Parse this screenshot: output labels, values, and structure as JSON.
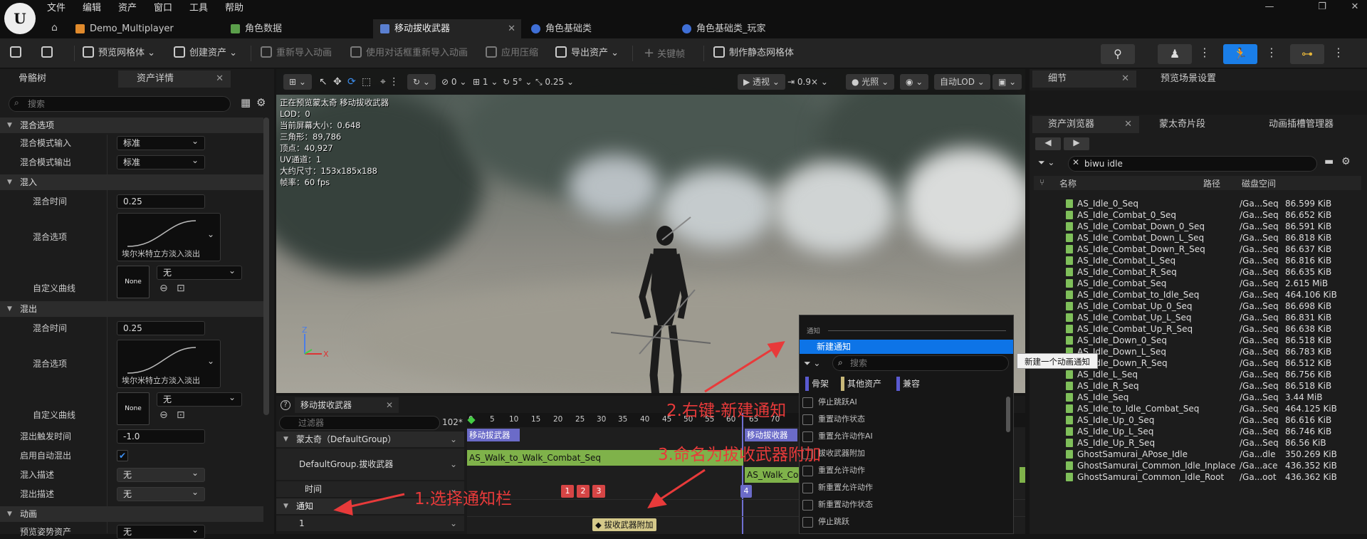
{
  "menu": {
    "items": [
      "文件",
      "编辑",
      "资产",
      "窗口",
      "工具",
      "帮助"
    ]
  },
  "tabs": [
    {
      "label": "Demo_Multiplayer"
    },
    {
      "label": "角色数据"
    },
    {
      "label": "移动拔收武器"
    },
    {
      "label": "角色基础类"
    },
    {
      "label": "角色基础类_玩家"
    }
  ],
  "toolbar": {
    "preview_mesh": "预览网格体",
    "create_asset": "创建资产",
    "reimport": "重新导入动画",
    "reimport_dialog": "使用对话框重新导入动画",
    "apply_compression": "应用压缩",
    "export_asset": "导出资产",
    "keyframe": "关键帧",
    "make_static_mesh": "制作静态网格体"
  },
  "left_panel": {
    "tabs": [
      "骨骼树",
      "资产详情"
    ],
    "search_placeholder": "搜索",
    "sections": {
      "blend_options": "混合选项",
      "blend_in": "混入",
      "blend_out": "混出",
      "animation": "动画"
    },
    "blend_mode_in_label": "混合模式输入",
    "blend_mode_in_value": "标准",
    "blend_mode_out_label": "混合模式输出",
    "blend_mode_out_value": "标准",
    "blend_time_label": "混合时间",
    "blend_in_time": "0.25",
    "blend_out_time": "0.25",
    "blend_option_label": "混合选项",
    "curve_caption": "埃尔米特立方淡入淡出",
    "custom_curve_label": "自定义曲线",
    "none_label": "None",
    "none_value": "无",
    "blend_out_trigger_label": "混出触发时间",
    "blend_out_trigger_value": "-1.0",
    "auto_blend_label": "启用自动混出",
    "blend_in_desc_label": "混入描述",
    "blend_in_desc_value": "无",
    "blend_out_desc_label": "混出描述",
    "blend_out_desc_value": "无",
    "preview_pose_label": "预览姿势资产",
    "preview_pose_value": "无"
  },
  "viewport": {
    "perspective": "透视",
    "lighting": "光照",
    "auto_lod": "自动LOD",
    "snap_values": [
      "0",
      "1",
      "5°",
      "0.25"
    ],
    "speed": "0.9×",
    "stats": [
      "正在预览蒙太奇 移动拔收武器",
      "LOD：0",
      "当前屏幕大小：0.648",
      "三角形：89,786",
      "顶点：40,927",
      "UV通道：1",
      "大约尺寸：153x185x188",
      "帧率：60 fps"
    ]
  },
  "sequencer": {
    "tab": "移动拔收武器",
    "filter_placeholder": "过滤器",
    "frame_count": "102*",
    "montage_row": "蒙太奇（DefaultGroup）",
    "slot_row": "DefaultGroup.拔收武器",
    "time_row": "时间",
    "notify_row": "通知",
    "notify_track": "1",
    "ticks": [
      "0",
      "5",
      "10",
      "15",
      "20",
      "25",
      "30",
      "35",
      "40",
      "45",
      "50",
      "55",
      "60",
      "65",
      "70"
    ],
    "section_a": "移动拔武器",
    "section_b": "移动拔收器",
    "clip_a": "AS_Walk_to_Walk_Combat_Seq",
    "clip_b": "AS_Walk_Co",
    "frames": [
      "1",
      "2",
      "3",
      "4"
    ],
    "notify_marker": "拔收武器附加"
  },
  "right_panel": {
    "tabs_top": [
      "细节",
      "预览场景设置"
    ],
    "tabs_mid": [
      "资产浏览器",
      "蒙太奇片段",
      "动画插槽管理器"
    ],
    "search_value": "biwu idle",
    "columns": [
      "名称",
      "路径",
      "磁盘空间"
    ],
    "assets": [
      {
        "name": "AS_Idle_0_Seq",
        "path": "/Ga...Seq",
        "size": "86.599 KiB"
      },
      {
        "name": "AS_Idle_Combat_0_Seq",
        "path": "/Ga...Seq",
        "size": "86.652 KiB"
      },
      {
        "name": "AS_Idle_Combat_Down_0_Seq",
        "path": "/Ga...Seq",
        "size": "86.591 KiB"
      },
      {
        "name": "AS_Idle_Combat_Down_L_Seq",
        "path": "/Ga...Seq",
        "size": "86.818 KiB"
      },
      {
        "name": "AS_Idle_Combat_Down_R_Seq",
        "path": "/Ga...Seq",
        "size": "86.637 KiB"
      },
      {
        "name": "AS_Idle_Combat_L_Seq",
        "path": "/Ga...Seq",
        "size": "86.816 KiB"
      },
      {
        "name": "AS_Idle_Combat_R_Seq",
        "path": "/Ga...Seq",
        "size": "86.635 KiB"
      },
      {
        "name": "AS_Idle_Combat_Seq",
        "path": "/Ga...Seq",
        "size": "2.615 MiB"
      },
      {
        "name": "AS_Idle_Combat_to_Idle_Seq",
        "path": "/Ga...Seq",
        "size": "464.106 KiB"
      },
      {
        "name": "AS_Idle_Combat_Up_0_Seq",
        "path": "/Ga...Seq",
        "size": "86.698 KiB"
      },
      {
        "name": "AS_Idle_Combat_Up_L_Seq",
        "path": "/Ga...Seq",
        "size": "86.831 KiB"
      },
      {
        "name": "AS_Idle_Combat_Up_R_Seq",
        "path": "/Ga...Seq",
        "size": "86.638 KiB"
      },
      {
        "name": "AS_Idle_Down_0_Seq",
        "path": "/Ga...Seq",
        "size": "86.518 KiB"
      },
      {
        "name": "AS_Idle_Down_L_Seq",
        "path": "/Ga...Seq",
        "size": "86.783 KiB"
      },
      {
        "name": "AS_Idle_Down_R_Seq",
        "path": "/Ga...Seq",
        "size": "86.512 KiB"
      },
      {
        "name": "AS_Idle_L_Seq",
        "path": "/Ga...Seq",
        "size": "86.756 KiB"
      },
      {
        "name": "AS_Idle_R_Seq",
        "path": "/Ga...Seq",
        "size": "86.518 KiB"
      },
      {
        "name": "AS_Idle_Seq",
        "path": "/Ga...Seq",
        "size": "3.44 MiB"
      },
      {
        "name": "AS_Idle_to_Idle_Combat_Seq",
        "path": "/Ga...Seq",
        "size": "464.125 KiB"
      },
      {
        "name": "AS_Idle_Up_0_Seq",
        "path": "/Ga...Seq",
        "size": "86.616 KiB"
      },
      {
        "name": "AS_Idle_Up_L_Seq",
        "path": "/Ga...Seq",
        "size": "86.746 KiB"
      },
      {
        "name": "AS_Idle_Up_R_Seq",
        "path": "/Ga...Seq",
        "size": "86.56 KiB"
      },
      {
        "name": "GhostSamurai_APose_Idle",
        "path": "/Ga...dle",
        "size": "350.269 KiB"
      },
      {
        "name": "GhostSamurai_Common_Idle_Inplace",
        "path": "/Ga...ace",
        "size": "436.352 KiB"
      },
      {
        "name": "GhostSamurai_Common_Idle_Root",
        "path": "/Ga...oot",
        "size": "436.362 KiB"
      }
    ]
  },
  "context_menu": {
    "header": "通知",
    "new_notify": "新建通知",
    "tooltip": "新建一个动画通知",
    "search_placeholder": "搜索",
    "filters": [
      "骨架",
      "其他资产",
      "兼容"
    ],
    "items": [
      "停止跳跃AI",
      "重置动作状态",
      "重置允许动作AI",
      "拔收武器附加",
      "重置允许动作",
      "新重置允许动作",
      "新重置动作状态",
      "重置允许动作",
      "停止跳跃"
    ]
  },
  "annotations": {
    "step1": "1.选择通知栏",
    "step2": "2.右键-新建通知",
    "step3": "3.命名为拔收武器附加"
  }
}
